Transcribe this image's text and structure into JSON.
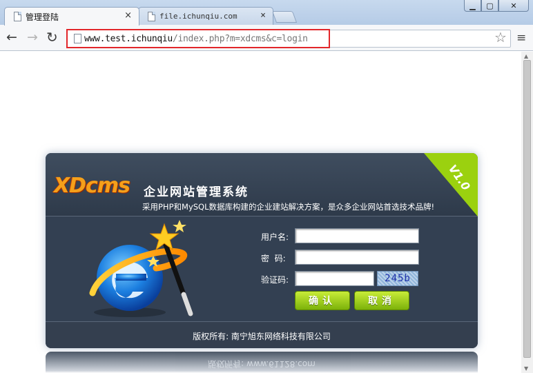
{
  "browser": {
    "tabs": [
      {
        "title": "管理登陆",
        "active": true
      },
      {
        "title": "file.ichunqiu.com",
        "active": false
      }
    ],
    "tab_close_glyph": "×",
    "window_buttons": [
      "▁",
      "▢",
      "✕"
    ],
    "nav": {
      "back": "←",
      "forward": "→",
      "reload": "↻"
    },
    "url_host": "www.test.ichunqiu",
    "url_rest": "/index.php?m=xdcms&c=login",
    "star": "☆",
    "menu": "≡",
    "highlight_color": "#e2262a"
  },
  "login": {
    "logo": "XDcms",
    "logo_subtitle": "企业网站管理系统",
    "slogan": "采用PHP和MySQL数据库构建的企业建站解决方案，是众多企业网站首选技术品牌!",
    "version": "V1.0",
    "username_label": "用户名:",
    "password_label": "密  码:",
    "captcha_label": "验证码:",
    "username_value": "",
    "password_value": "",
    "captcha_value": "",
    "captcha_image_text": "245b",
    "confirm_button": "确认",
    "cancel_button": "取消",
    "copyright": "版权所有: 南宁旭东网络科技有限公司",
    "reflection_text": "版权所有: www.61128.com",
    "accent_color": "#9bd10f",
    "panel_color": "#334052"
  }
}
